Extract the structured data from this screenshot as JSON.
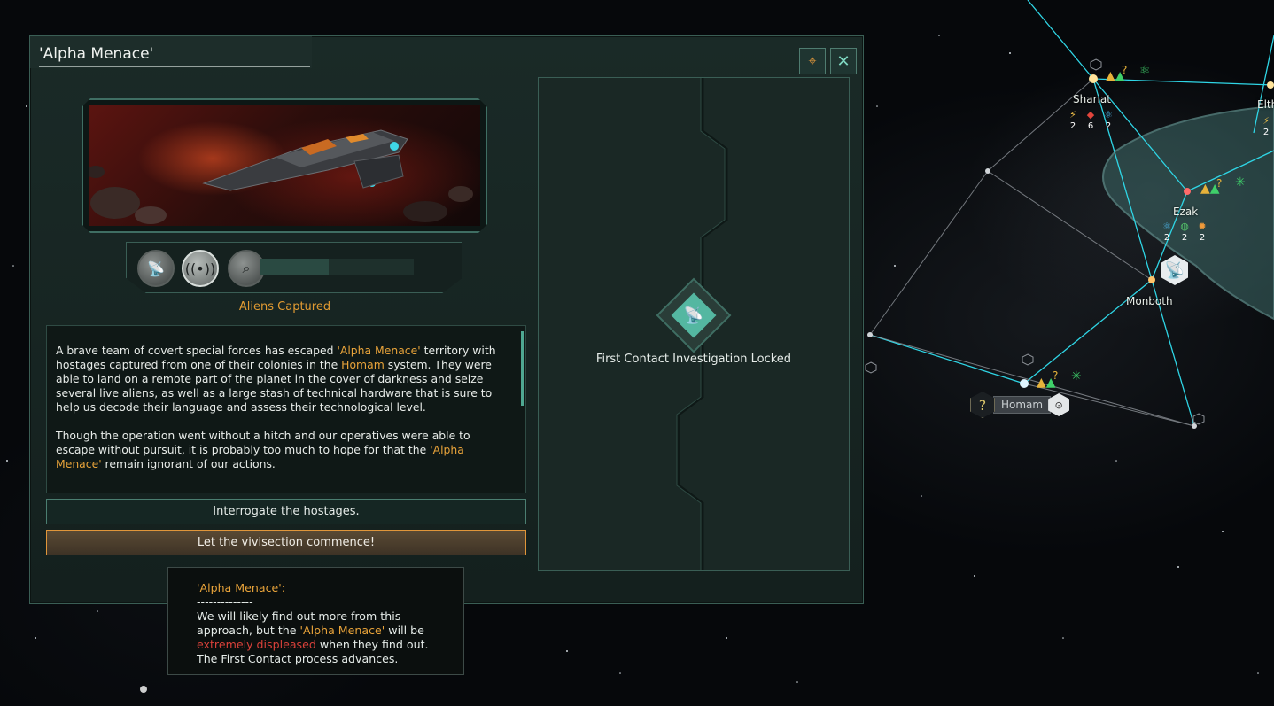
{
  "event": {
    "title": "'Alpha Menace'",
    "stage_name": "Aliens Captured",
    "description": [
      [
        {
          "t": "A brave team of covert special forces has escaped "
        },
        {
          "t": "'Alpha Menace'",
          "hl": true
        },
        {
          "t": " territory with hostages captured from one of their colonies in the "
        },
        {
          "t": "Homam",
          "hl": true
        },
        {
          "t": " system. They were able to land on a remote part of the planet in the cover of darkness and seize several live aliens, as well as a large stash of technical hardware that is sure to help us decode their language and assess their technological level."
        }
      ],
      [
        {
          "t": "Though the operation went without a hitch and our operatives were able to escape without pursuit, it is probably too much to hope for that the "
        },
        {
          "t": "'Alpha Menace'",
          "hl": true
        },
        {
          "t": " remain ignorant of our actions."
        }
      ]
    ],
    "options": [
      {
        "label": "Interrogate the hostages."
      },
      {
        "label": "Let the vivisection commence!"
      }
    ],
    "investigation_text": "First Contact Investigation Locked",
    "progress": 0.45,
    "stage_icons": [
      "satellite-dish-icon",
      "signal-icon",
      "telescope-icon"
    ]
  },
  "tooltip": {
    "header": "'Alpha Menace':",
    "separator": "--------------",
    "line_a": "We will likely find out more from this approach, but the ",
    "empire": "'Alpha Menace'",
    "line_b": " will be ",
    "warning": "extremely displeased",
    "line_c": " when they find out.",
    "line_d": "The First Contact process advances."
  },
  "map": {
    "systems": [
      {
        "name": "Shariat",
        "resources": [
          {
            "icon": "energy-icon",
            "value": "2"
          },
          {
            "icon": "minerals-icon",
            "value": "6"
          },
          {
            "icon": "research-icon",
            "value": "2"
          }
        ]
      },
      {
        "name": "Ezak",
        "resources": [
          {
            "icon": "research-icon",
            "value": "2"
          },
          {
            "icon": "society-icon",
            "value": "2"
          },
          {
            "icon": "engineering-icon",
            "value": "2"
          }
        ]
      },
      {
        "name": "Monboth"
      },
      {
        "name": "Homam"
      },
      {
        "name": "Elth",
        "resources": [
          {
            "icon": "energy-icon",
            "value": "2"
          }
        ]
      }
    ],
    "unknown_marker": "?"
  },
  "colors": {
    "accent_orange": "#e8a33a",
    "warning_red": "#d9413a",
    "hyperlane": "#2fd6e6",
    "panel_border": "#3a5e55"
  }
}
